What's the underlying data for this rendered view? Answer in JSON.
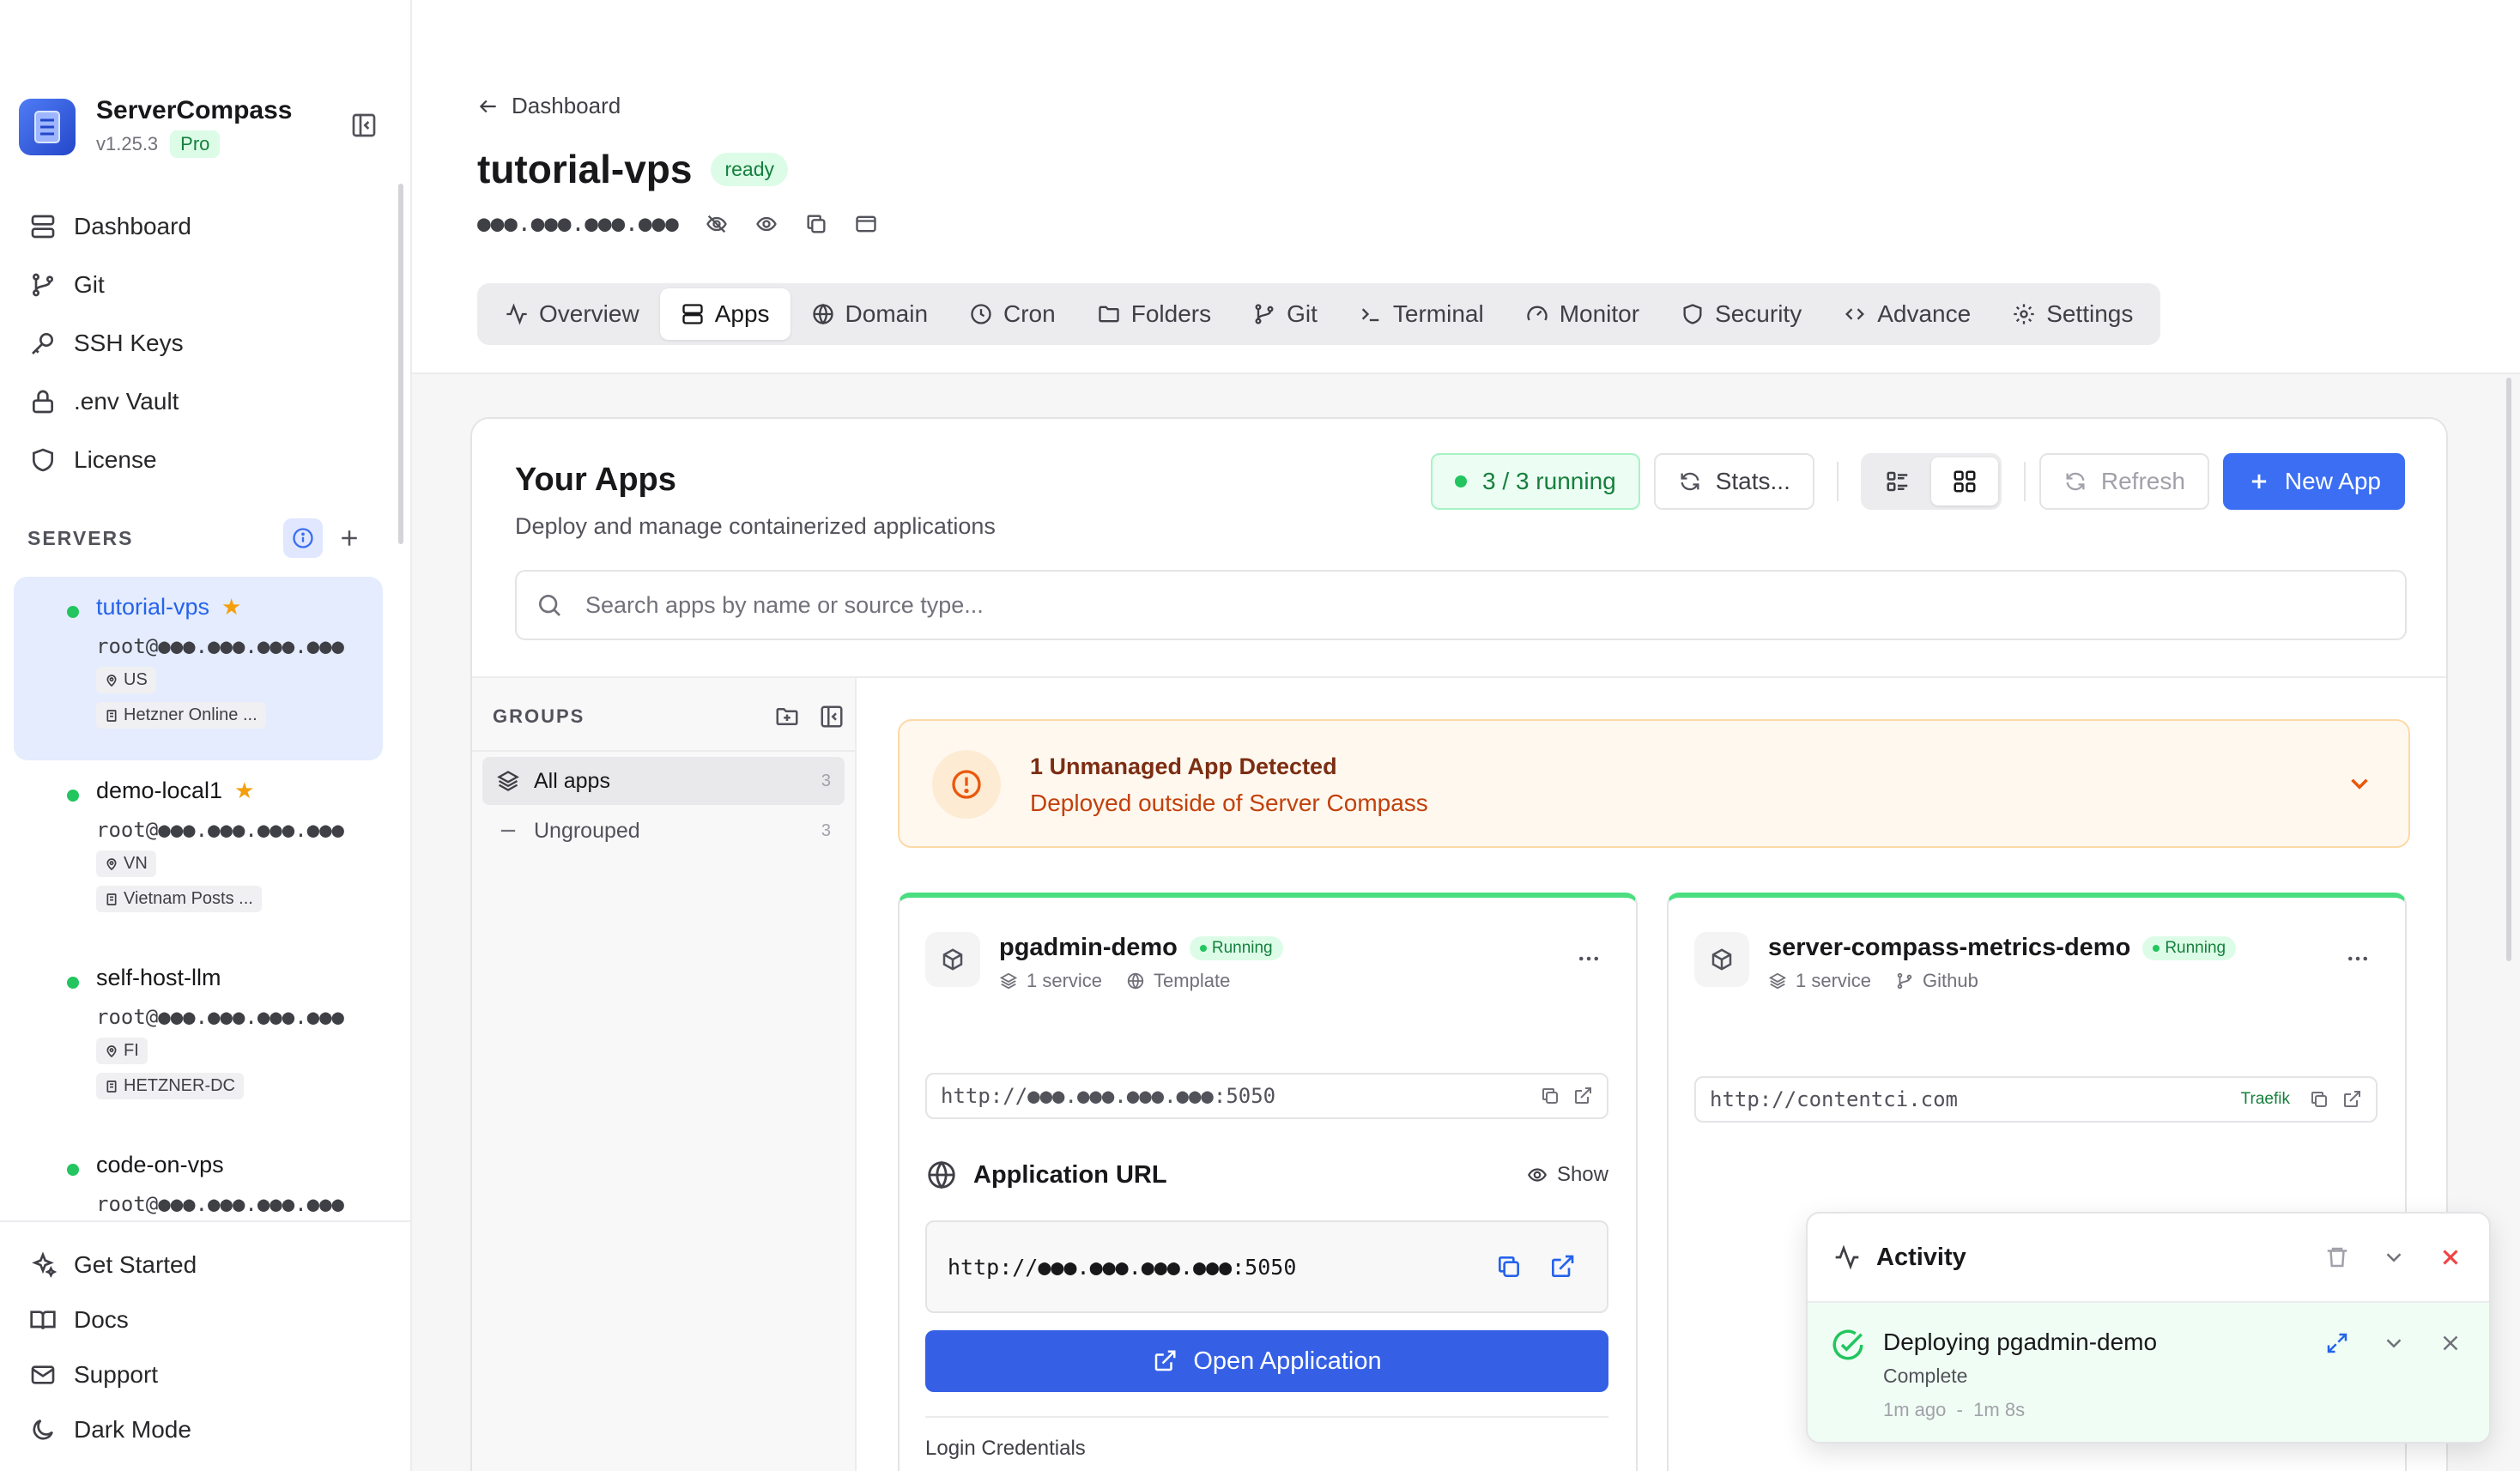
{
  "app": {
    "name": "ServerCompass",
    "version": "v1.25.3",
    "plan": "Pro"
  },
  "nav": [
    {
      "label": "Dashboard",
      "icon": "dashboard-icon"
    },
    {
      "label": "Git",
      "icon": "git-branch-icon"
    },
    {
      "label": "SSH Keys",
      "icon": "key-icon"
    },
    {
      "label": ".env Vault",
      "icon": "lock-icon"
    },
    {
      "label": "License",
      "icon": "shield-icon"
    }
  ],
  "servers_title": "SERVERS",
  "servers": [
    {
      "name": "tutorial-vps",
      "host": "root@●●●.●●●.●●●.●●●",
      "region": "US",
      "provider": "Hetzner Online ...",
      "starred": true
    },
    {
      "name": "demo-local1",
      "host": "root@●●●.●●●.●●●.●●●",
      "region": "VN",
      "provider": "Vietnam Posts ...",
      "starred": true
    },
    {
      "name": "self-host-llm",
      "host": "root@●●●.●●●.●●●.●●●",
      "region": "FI",
      "provider": "HETZNER-DC",
      "starred": false
    },
    {
      "name": "code-on-vps",
      "host": "root@●●●.●●●.●●●.●●●",
      "region": "",
      "provider": "",
      "starred": false
    }
  ],
  "footer_nav": [
    {
      "label": "Get Started",
      "icon": "sparkles-icon"
    },
    {
      "label": "Docs",
      "icon": "book-icon"
    },
    {
      "label": "Support",
      "icon": "mail-icon"
    },
    {
      "label": "Dark Mode",
      "icon": "moon-icon"
    }
  ],
  "header": {
    "back_label": "Dashboard",
    "title": "tutorial-vps",
    "status": "ready",
    "ip": "●●●.●●●.●●●.●●●"
  },
  "tabs": [
    {
      "label": "Overview",
      "icon": "activity-icon",
      "active": false
    },
    {
      "label": "Apps",
      "icon": "server-icon",
      "active": true
    },
    {
      "label": "Domain",
      "icon": "globe-icon",
      "active": false
    },
    {
      "label": "Cron",
      "icon": "clock-icon",
      "active": false
    },
    {
      "label": "Folders",
      "icon": "folder-icon",
      "active": false
    },
    {
      "label": "Git",
      "icon": "git-branch-icon",
      "active": false
    },
    {
      "label": "Terminal",
      "icon": "terminal-icon",
      "active": false
    },
    {
      "label": "Monitor",
      "icon": "gauge-icon",
      "active": false
    },
    {
      "label": "Security",
      "icon": "shield-icon",
      "active": false
    },
    {
      "label": "Advance",
      "icon": "code-icon",
      "active": false
    },
    {
      "label": "Settings",
      "icon": "gear-icon",
      "active": false
    }
  ],
  "apps_section": {
    "title": "Your Apps",
    "subtitle": "Deploy and manage containerized applications",
    "running_label": "3 / 3 running",
    "stats_label": "Stats...",
    "refresh_label": "Refresh",
    "new_app_label": "New App",
    "search_placeholder": "Search apps by name or source type..."
  },
  "groups": {
    "title": "GROUPS",
    "items": [
      {
        "label": "All apps",
        "count": "3",
        "active": true
      },
      {
        "label": "Ungrouped",
        "count": "3",
        "active": false
      }
    ]
  },
  "alert": {
    "title": "1 Unmanaged App Detected",
    "subtitle": "Deployed outside of Server Compass"
  },
  "app_cards": [
    {
      "name": "pgadmin-demo",
      "status": "Running",
      "services": "1 service",
      "source": "Template",
      "url": "http://●●●.●●●.●●●.●●●:5050",
      "app_url_title": "Application URL",
      "show_label": "Show",
      "app_url": "http://●●●.●●●.●●●.●●●:5050",
      "open_label": "Open Application",
      "login_label": "Login Credentials"
    },
    {
      "name": "server-compass-metrics-demo",
      "status": "Running",
      "services": "1 service",
      "source": "Github",
      "url": "http://contentci.com",
      "proxy": "Traefik"
    }
  ],
  "activity": {
    "title": "Activity",
    "item_name": "Deploying pgadmin-demo",
    "item_status": "Complete",
    "item_time": "1m ago",
    "item_duration": "1m 8s"
  },
  "colors": {
    "accent": "#3b6ef2",
    "success": "#22c55e",
    "warning": "#c2410c",
    "star": "#f59e0b"
  }
}
